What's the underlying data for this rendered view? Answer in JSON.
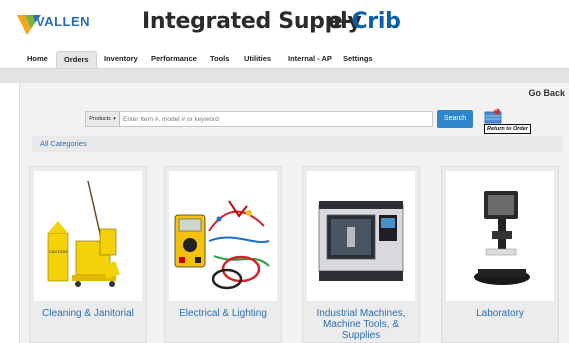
{
  "brand": {
    "logo_text": "VALLEN",
    "title": "Integrated Supply",
    "ecrib_e": "e-",
    "ecrib_crib": "Crib"
  },
  "nav": {
    "items": [
      {
        "label": "Home"
      },
      {
        "label": "Orders",
        "active": true
      },
      {
        "label": "Inventory"
      },
      {
        "label": "Performance"
      },
      {
        "label": "Tools"
      },
      {
        "label": "Utilities"
      },
      {
        "label": "Internal - AP"
      },
      {
        "label": "Settings"
      }
    ]
  },
  "goback": "Go Back",
  "search": {
    "scope_label": "Products",
    "placeholder": "Enter Item #, model # or keyword",
    "button_label": "Search"
  },
  "cart": {
    "badge": "0",
    "label": "Return to Order"
  },
  "categories": {
    "all_label": "All Categories",
    "items": [
      {
        "label": "Cleaning & Janitorial"
      },
      {
        "label": "Electrical & Lighting"
      },
      {
        "label": "Industrial Machines, Machine Tools, & Supplies"
      },
      {
        "label": "Laboratory"
      }
    ]
  },
  "colors": {
    "link": "#2a6fb5",
    "search_button": "#2d86c9",
    "brand_blue": "#0b5fa8"
  }
}
